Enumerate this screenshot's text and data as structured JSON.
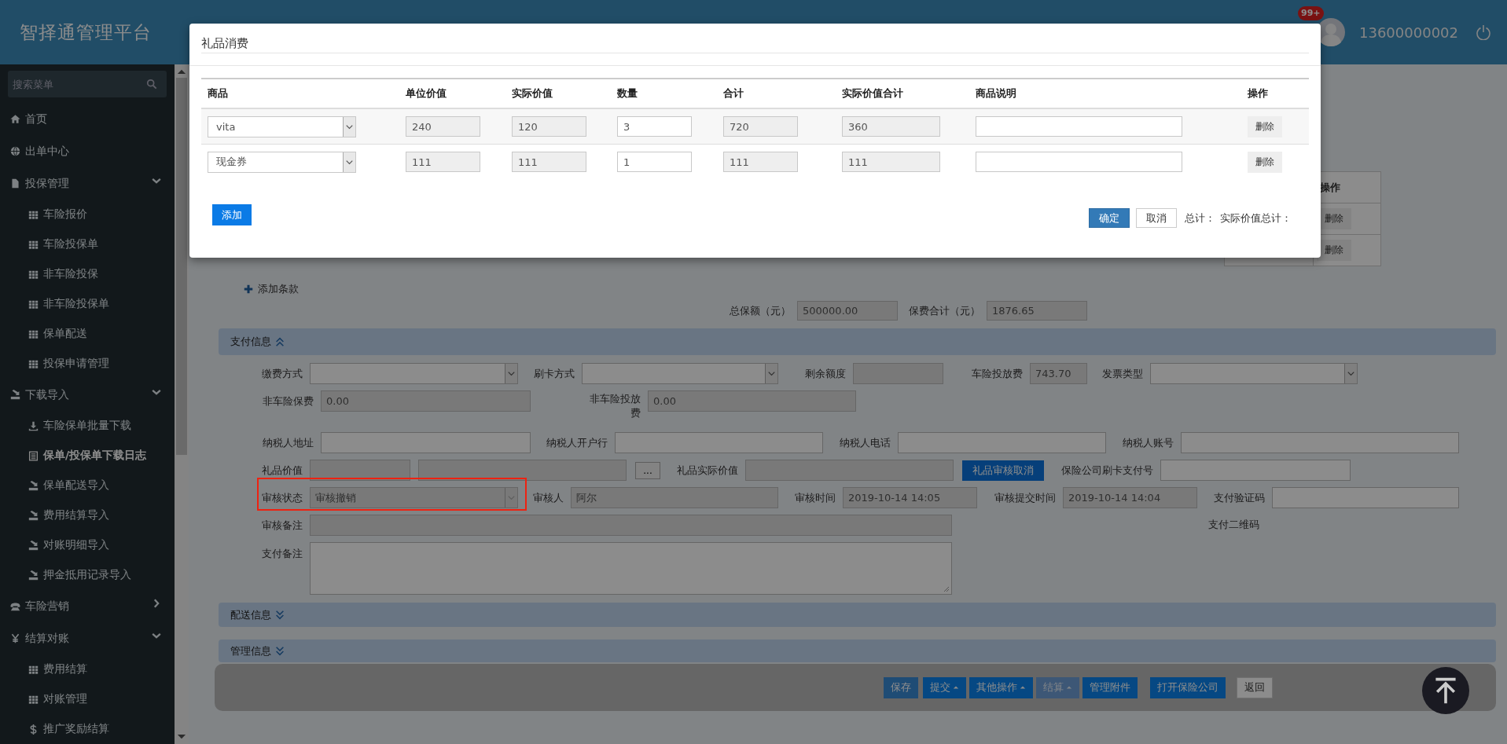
{
  "header": {
    "title": "智择通管理平台",
    "notification_badge": "99+",
    "username": "13600000002"
  },
  "sidebar": {
    "search_placeholder": "搜索菜单",
    "items": [
      {
        "label": "首页",
        "kind": "home",
        "selected": false
      },
      {
        "label": "出单中心",
        "kind": "globe",
        "selected": false
      },
      {
        "label": "投保管理",
        "kind": "file",
        "selected": false,
        "expanded": true,
        "children": [
          {
            "label": "车险报价",
            "kind": "grid",
            "selected": false
          },
          {
            "label": "车险投保单",
            "kind": "grid",
            "selected": false
          },
          {
            "label": "非车险投保",
            "kind": "grid",
            "selected": false
          },
          {
            "label": "非车险投保单",
            "kind": "grid",
            "selected": false
          },
          {
            "label": "保单配送",
            "kind": "grid",
            "selected": false
          },
          {
            "label": "投保申请管理",
            "kind": "grid",
            "selected": false
          }
        ]
      },
      {
        "label": "下载导入",
        "kind": "import",
        "selected": false,
        "expanded": true,
        "children": [
          {
            "label": "车险保单批量下载",
            "kind": "download",
            "selected": false
          },
          {
            "label": "保单/投保单下载日志",
            "kind": "log",
            "selected": true
          },
          {
            "label": "保单配送导入",
            "kind": "import",
            "selected": false
          },
          {
            "label": "费用结算导入",
            "kind": "import",
            "selected": false
          },
          {
            "label": "对账明细导入",
            "kind": "import",
            "selected": false
          },
          {
            "label": "押金抵用记录导入",
            "kind": "import",
            "selected": false
          }
        ]
      },
      {
        "label": "车险营销",
        "kind": "phone",
        "selected": false,
        "expanded": false
      },
      {
        "label": "结算对账",
        "kind": "yen",
        "selected": false,
        "expanded": true,
        "children": [
          {
            "label": "费用结算",
            "kind": "grid",
            "selected": false
          },
          {
            "label": "对账管理",
            "kind": "grid",
            "selected": false
          },
          {
            "label": "推广奖励结算",
            "kind": "dollar",
            "selected": false
          }
        ]
      }
    ]
  },
  "clause_table": {
    "column": "操作",
    "rows": [
      {
        "action": "删除"
      },
      {
        "action": "删除"
      }
    ]
  },
  "add_clause": "添加条款",
  "totals": [
    {
      "label": "总保额（元）",
      "value": "500000.00"
    },
    {
      "label": "保费合计（元）",
      "value": "1876.65"
    }
  ],
  "sections": [
    {
      "title": "支付信息",
      "expanded": true,
      "rows": [
        {
          "fields": [
            {
              "label": "缴费方式",
              "kind": "select",
              "disabled": false
            },
            {
              "label": "刷卡方式",
              "kind": "select",
              "disabled": false
            },
            {
              "label": "剩余额度",
              "kind": "text",
              "disabled": true
            },
            {
              "label": "车险投放费",
              "kind": "text",
              "value": "743.70",
              "disabled": true
            },
            {
              "label": "发票类型",
              "kind": "select",
              "disabled": false
            }
          ]
        },
        {
          "fields": [
            {
              "label": "非车险保费",
              "kind": "text",
              "value": "0.00",
              "disabled": true
            },
            {
              "label": "非车险投放费",
              "kind": "text",
              "value": "0.00",
              "disabled": true
            }
          ]
        },
        {
          "fields": [
            {
              "label": "纳税人地址",
              "kind": "text",
              "disabled": false
            },
            {
              "label": "纳税人开户行",
              "kind": "text",
              "disabled": false
            },
            {
              "label": "纳税人电话",
              "kind": "text",
              "disabled": false
            },
            {
              "label": "纳税人账号",
              "kind": "text",
              "disabled": false
            }
          ]
        },
        {
          "fields": [
            {
              "label": "礼品价值",
              "kind": "text",
              "disabled": true
            },
            {
              "kind": "text",
              "disabled": true
            },
            {
              "kind": "button",
              "text": "...",
              "disabled": false
            },
            {
              "label": "礼品实际价值",
              "kind": "text",
              "disabled": true
            },
            {
              "kind": "action-button",
              "text": "礼品审核取消",
              "disabled": false
            },
            {
              "label": "保险公司刷卡支付号",
              "kind": "text",
              "disabled": false
            }
          ]
        },
        {
          "fields": [
            {
              "label": "审核状态",
              "kind": "select",
              "value": "审核撤销",
              "disabled": true,
              "highlighted": true
            },
            {
              "label": "审核人",
              "kind": "text",
              "value": "阿尔",
              "disabled": true
            },
            {
              "label": "审核时间",
              "kind": "text",
              "value": "2019-10-14 14:05",
              "disabled": true
            },
            {
              "label": "审核提交时间",
              "kind": "text",
              "value": "2019-10-14 14:04",
              "disabled": true
            },
            {
              "label": "支付验证码",
              "kind": "text",
              "disabled": false
            }
          ]
        },
        {
          "fields": [
            {
              "label": "审核备注",
              "kind": "text",
              "disabled": true
            },
            {
              "label": "支付二维码",
              "kind": "caption"
            }
          ]
        },
        {
          "fields": [
            {
              "label": "支付备注",
              "kind": "textarea",
              "disabled": false
            }
          ]
        }
      ]
    },
    {
      "title": "配送信息",
      "expanded": false
    },
    {
      "title": "管理信息",
      "expanded": false
    }
  ],
  "action_bar": {
    "buttons": [
      {
        "label": "保存",
        "kind": "save",
        "dropdown": false,
        "disabled": false
      },
      {
        "label": "提交",
        "kind": "primary",
        "dropdown": true,
        "disabled": false
      },
      {
        "label": "其他操作",
        "kind": "primary",
        "dropdown": true,
        "disabled": false
      },
      {
        "label": "结算",
        "kind": "primary",
        "dropdown": true,
        "disabled": true
      },
      {
        "label": "管理附件",
        "kind": "primary",
        "dropdown": false,
        "disabled": false
      },
      {
        "label": "打开保险公司",
        "kind": "primary",
        "dropdown": false,
        "disabled": false
      },
      {
        "label": "返回",
        "kind": "default",
        "dropdown": false,
        "disabled": false
      }
    ]
  },
  "dialog": {
    "title": "礼品消费",
    "columns": [
      "商品",
      "单位价值",
      "实际价值",
      "数量",
      "合计",
      "实际价值合计",
      "商品说明",
      "操作"
    ],
    "rows": [
      {
        "product": "vita",
        "unit_value": "240",
        "actual_value": "120",
        "quantity": "3",
        "total": "720",
        "actual_total": "360",
        "action": "删除"
      },
      {
        "product": "现金券",
        "unit_value": "111",
        "actual_value": "111",
        "quantity": "1",
        "total": "111",
        "actual_total": "111",
        "action": "删除"
      }
    ],
    "add_button": "添加",
    "confirm_button": "确定",
    "cancel_button": "取消",
    "summary": [
      "总计：",
      "实际价值总计："
    ]
  }
}
